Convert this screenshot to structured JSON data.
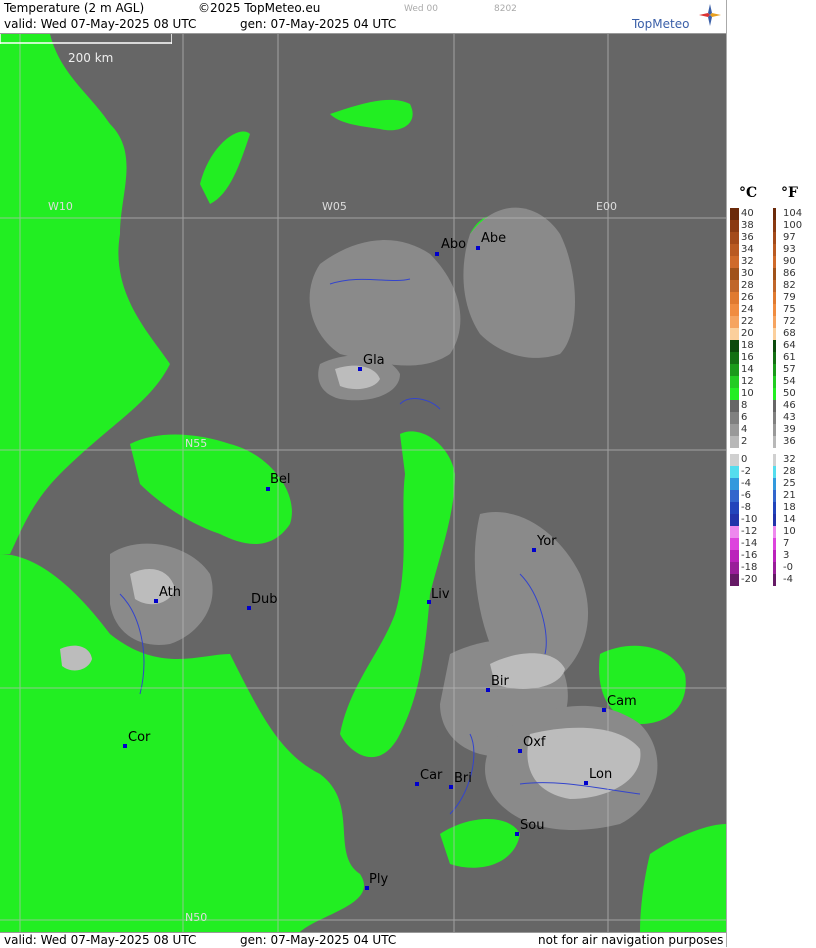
{
  "header": {
    "product": "Temperature (2 m AGL)",
    "copyright": "©2025 TopMeteo.eu",
    "run_code": "Wed 00",
    "map_code": "8202",
    "valid": "valid:  Wed  07-May-2025  08 UTC",
    "gen": "gen: 07-May-2025 04 UTC",
    "logo_text": "TopMeteo"
  },
  "footer": {
    "valid": "valid:  Wed  07-May-2025  08 UTC",
    "gen": "gen: 07-May-2025 04 UTC",
    "disclaimer": "not for air navigation purposes"
  },
  "map": {
    "scale_label": "200 km",
    "grid_labels": [
      "W10",
      "W05",
      "E00",
      "N55",
      "N50"
    ],
    "cities": [
      {
        "name": "Abo"
      },
      {
        "name": "Abe"
      },
      {
        "name": "Gla"
      },
      {
        "name": "Bel"
      },
      {
        "name": "Yor"
      },
      {
        "name": "Ath"
      },
      {
        "name": "Dub"
      },
      {
        "name": "Liv"
      },
      {
        "name": "Bir"
      },
      {
        "name": "Cam"
      },
      {
        "name": "Cor"
      },
      {
        "name": "Oxf"
      },
      {
        "name": "Car"
      },
      {
        "name": "Bri"
      },
      {
        "name": "Lon"
      },
      {
        "name": "Sou"
      },
      {
        "name": "Ply"
      }
    ],
    "colors": {
      "land_dark": "#666666",
      "sea_green": "#22ee22",
      "warm_grey": "#8a8a8a",
      "light_grey": "#bcbcbc"
    }
  },
  "legend": {
    "unit_c": "°C",
    "unit_f": "°F",
    "rows": [
      {
        "c": "40",
        "f": "104",
        "color": "#6b2a0a"
      },
      {
        "c": "38",
        "f": "100",
        "color": "#8a3a12"
      },
      {
        "c": "36",
        "f": "97",
        "color": "#a34a1a"
      },
      {
        "c": "34",
        "f": "93",
        "color": "#b95a22"
      },
      {
        "c": "32",
        "f": "90",
        "color": "#cf6a2a"
      },
      {
        "c": "30",
        "f": "86",
        "color": "#a0521a"
      },
      {
        "c": "28",
        "f": "82",
        "color": "#c0662a"
      },
      {
        "c": "26",
        "f": "79",
        "color": "#e07a30"
      },
      {
        "c": "24",
        "f": "75",
        "color": "#f08c40"
      },
      {
        "c": "22",
        "f": "72",
        "color": "#f6a460"
      },
      {
        "c": "20",
        "f": "68",
        "color": "#fbcf9c"
      },
      {
        "c": "18",
        "f": "64",
        "color": "#0c4a0c"
      },
      {
        "c": "16",
        "f": "61",
        "color": "#137013"
      },
      {
        "c": "14",
        "f": "57",
        "color": "#1a9a1a"
      },
      {
        "c": "12",
        "f": "54",
        "color": "#22cc22"
      },
      {
        "c": "10",
        "f": "50",
        "color": "#22ee22"
      },
      {
        "c": "8",
        "f": "46",
        "color": "#666666"
      },
      {
        "c": "6",
        "f": "43",
        "color": "#808080"
      },
      {
        "c": "4",
        "f": "39",
        "color": "#999999"
      },
      {
        "c": "2",
        "f": "36",
        "color": "#b8b8b8"
      },
      {
        "c": "0",
        "f": "32",
        "color": "#d0d0d0"
      },
      {
        "c": "-2",
        "f": "28",
        "color": "#55ddee"
      },
      {
        "c": "-4",
        "f": "25",
        "color": "#3399dd"
      },
      {
        "c": "-6",
        "f": "21",
        "color": "#3366cc"
      },
      {
        "c": "-8",
        "f": "18",
        "color": "#2244bb"
      },
      {
        "c": "-10",
        "f": "14",
        "color": "#2233aa"
      },
      {
        "c": "-12",
        "f": "10",
        "color": "#ee88ee"
      },
      {
        "c": "-14",
        "f": "7",
        "color": "#dd44dd"
      },
      {
        "c": "-16",
        "f": "3",
        "color": "#bb22bb"
      },
      {
        "c": "-18",
        "f": "-0",
        "color": "#991e99"
      },
      {
        "c": "-20",
        "f": "-4",
        "color": "#661a66"
      }
    ]
  }
}
